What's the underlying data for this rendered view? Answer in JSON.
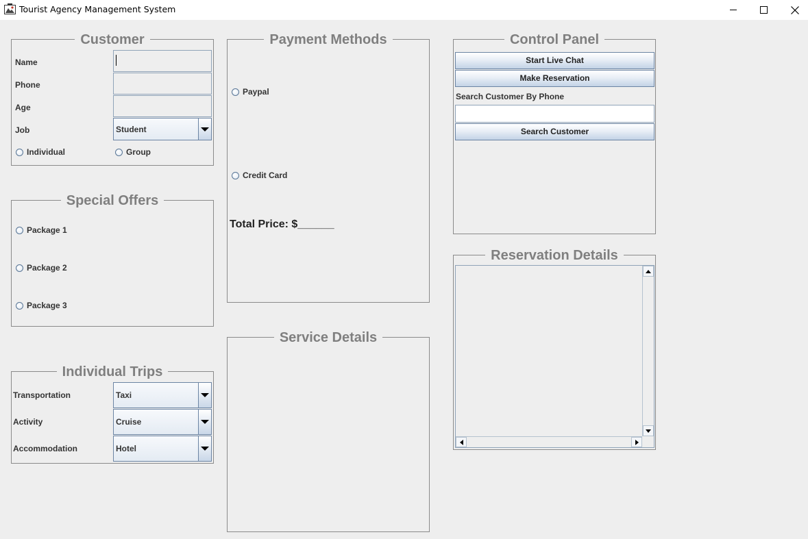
{
  "window": {
    "title": "Tourist Agency Management System"
  },
  "customer": {
    "title": "Customer",
    "name_label": "Name",
    "phone_label": "Phone",
    "age_label": "Age",
    "job_label": "Job",
    "job_value": "Student",
    "name_value": "",
    "phone_value": "",
    "age_value": "",
    "individual_label": "Individual",
    "group_label": "Group"
  },
  "special_offers": {
    "title": "Special Offers",
    "packages": [
      "Package 1",
      "Package 2",
      "Package 3"
    ]
  },
  "individual_trips": {
    "title": "Individual Trips",
    "transportation_label": "Transportation",
    "transportation_value": "Taxi",
    "activity_label": "Activity",
    "activity_value": "Cruise",
    "accommodation_label": "Accommodation",
    "accommodation_value": "Hotel"
  },
  "payment_methods": {
    "title": "Payment Methods",
    "paypal_label": "Paypal",
    "credit_card_label": "Credit Card",
    "total_price_label": "Total Price: $______"
  },
  "service_details": {
    "title": "Service Details"
  },
  "control_panel": {
    "title": "Control Panel",
    "start_live_chat_label": "Start Live Chat",
    "make_reservation_label": "Make Reservation",
    "search_label": "Search Customer By Phone",
    "search_value": "",
    "search_button_label": "Search Customer"
  },
  "reservation_details": {
    "title": "Reservation Details"
  },
  "icons": {
    "app": "app-icon",
    "minimize": "minimize-icon",
    "maximize": "maximize-icon",
    "close": "close-icon"
  },
  "colors": {
    "background": "#eeeeee",
    "panel_title": "#7f7f7f",
    "border": "#8a8a8a",
    "control_border": "#6b84a3"
  }
}
